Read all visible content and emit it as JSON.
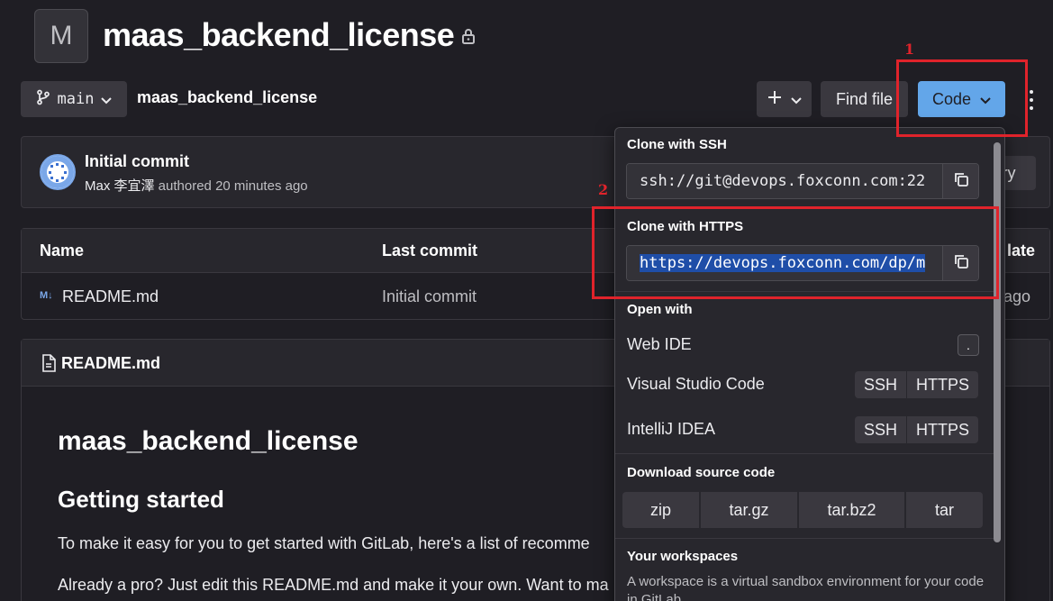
{
  "project": {
    "initial": "M",
    "title": "maas_backend_license"
  },
  "toolbar": {
    "branch": "main",
    "breadcrumb": "maas_backend_license",
    "plus": "+",
    "find_file": "Find file",
    "code": "Code"
  },
  "commit": {
    "title": "Initial commit",
    "author": "Max 李宜澤",
    "meta": " authored 20 minutes ago",
    "history_btn": "ry"
  },
  "table": {
    "headers": [
      "Name",
      "Last commit",
      "late"
    ],
    "rows": [
      {
        "name": "README.md",
        "last_commit": "Initial commit",
        "date": "ago"
      }
    ]
  },
  "readme": {
    "file": "README.md",
    "h1": "maas_backend_license",
    "h2": "Getting started",
    "p1": "To make it easy for you to get started with GitLab, here's a list of recomme",
    "p2": "Already a pro? Just edit this README.md and make it your own. Want to ma"
  },
  "dropdown": {
    "ssh_label": "Clone with SSH",
    "ssh_url": "ssh://git@devops.foxconn.com:22",
    "https_label": "Clone with HTTPS",
    "https_url": "https://devops.foxconn.com/dp/m",
    "open_with": "Open with",
    "web_ide": "Web IDE",
    "web_ide_key": ".",
    "vscode": "Visual Studio Code",
    "intellij": "IntelliJ IDEA",
    "ssh": "SSH",
    "https": "HTTPS",
    "download_label": "Download source code",
    "downloads": [
      "zip",
      "tar.gz",
      "tar.bz2",
      "tar"
    ],
    "workspaces_label": "Your workspaces",
    "workspaces_text": "A workspace is a virtual sandbox environment for your code in GitLab."
  },
  "annotations": {
    "one": "1",
    "two": "2",
    "color": "#e0232b"
  }
}
